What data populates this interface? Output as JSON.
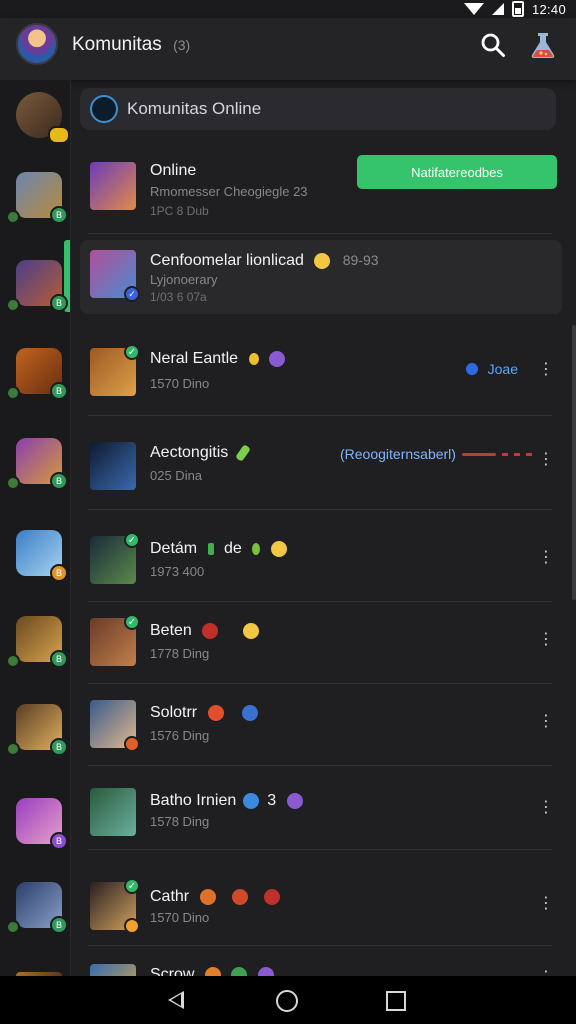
{
  "status_bar": {
    "time": "12:40"
  },
  "app_bar": {
    "title": "Komunitas",
    "title_count": "(3)"
  },
  "search": {
    "text": "Komunitas Online"
  },
  "featured": {
    "title": "Online",
    "subtitle": "Rmomesser Cheogiegle 23",
    "meta": "1PC 8 Dub",
    "button_label": "Natifatereodbes"
  },
  "selected": {
    "title": "Cenfoomelar lionlicad",
    "time": "89-93",
    "subtitle": "Lyjonoerary",
    "meta": "1/03 6 07a"
  },
  "rows": [
    {
      "title": "Neral Eantle",
      "meta": "1570 Dino",
      "link": "Joae"
    },
    {
      "title": "Aectongitis",
      "meta": "025 Dina",
      "tag": "(Reoogiternsaberl)"
    },
    {
      "title": "Detám",
      "title_suffix": "de",
      "meta": "1973 400"
    },
    {
      "title": "Beten",
      "meta": "1778 Ding"
    },
    {
      "title": "Solotrr",
      "meta": "1576 Ding"
    },
    {
      "title": "Batho Irnien",
      "title_suffix": "3",
      "meta": "1578 Ding"
    },
    {
      "title": "Cathr",
      "meta": "1570 Dino"
    },
    {
      "title": "Scrow"
    }
  ],
  "colors": {
    "accent_green": "#35c36c",
    "link_blue": "#5aa7ff",
    "background": "#1f1f21"
  },
  "icons": {
    "search": "search-icon",
    "action": "flask-icon",
    "more": "more-vertical-icon"
  }
}
